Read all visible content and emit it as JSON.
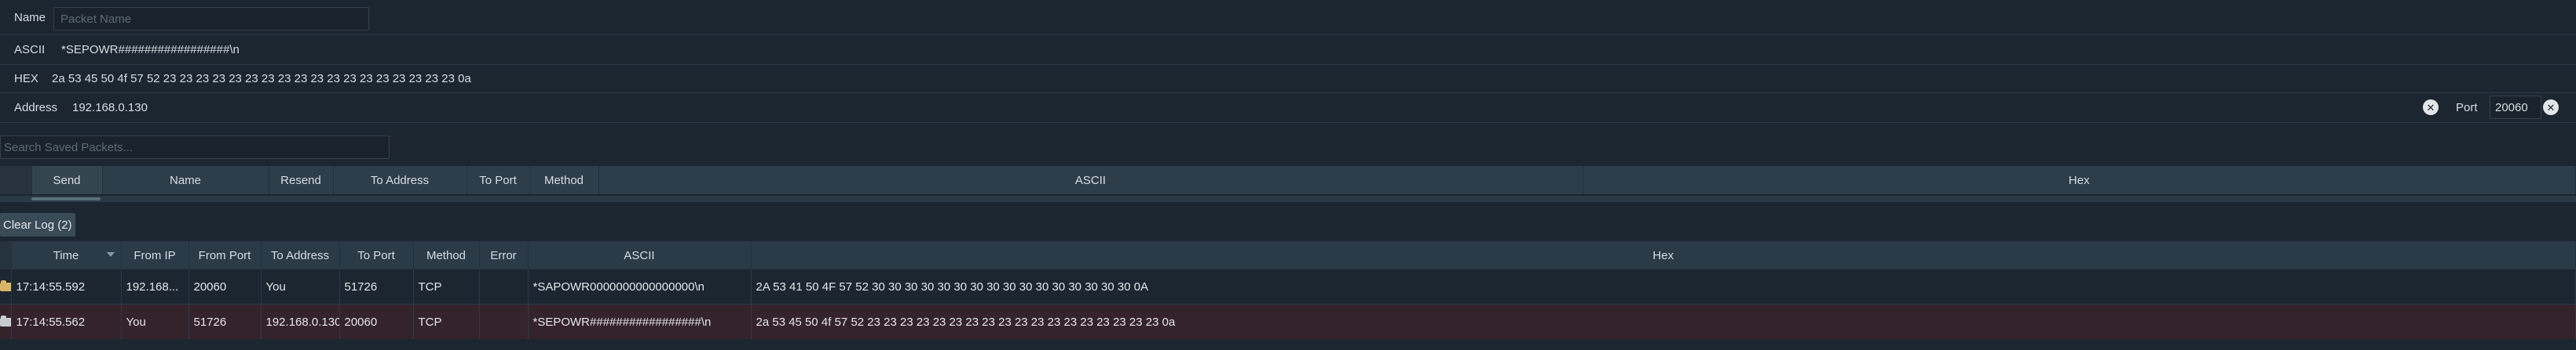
{
  "form": {
    "name_label": "Name",
    "name_placeholder": "Packet Name",
    "ascii_label": "ASCII",
    "ascii_value": "*SEPOWR#################\\n",
    "hex_label": "HEX",
    "hex_value": "2a 53 45 50 4f 57 52 23 23 23 23 23 23 23 23 23 23 23 23 23 23 23 23 23 23 0a",
    "address_label": "Address",
    "address_value": "192.168.0.130",
    "port_label": "Port",
    "port_value": "20060",
    "clear_glyph": "✕"
  },
  "saved": {
    "search_placeholder": "Search Saved Packets...",
    "columns": [
      "Send",
      "Name",
      "Resend",
      "To Address",
      "To Port",
      "Method",
      "ASCII",
      "Hex"
    ]
  },
  "log": {
    "clear_button_label": "Clear Log (2)",
    "columns": [
      "Time",
      "From IP",
      "From Port",
      "To Address",
      "To Port",
      "Method",
      "Error",
      "ASCII",
      "Hex"
    ],
    "rows": [
      {
        "icon": "folder-open-icon",
        "icon_color": "#d9b56a",
        "time": "17:14:55.592",
        "from_ip": "192.168...",
        "from_port": "20060",
        "to_address": "You",
        "to_port": "51726",
        "method": "TCP",
        "error": "",
        "ascii": "*SAPOWR0000000000000000\\n",
        "hex": "2A 53 41 50 4F 57 52 30 30 30 30 30 30 30 30 30 30 30 30 30 30 30 30 0A"
      },
      {
        "icon": "folder-closed-icon",
        "icon_color": "#c7ccd1",
        "time": "17:14:55.562",
        "from_ip": "You",
        "from_port": "51726",
        "to_address": "192.168.0.130",
        "to_port": "20060",
        "method": "TCP",
        "error": "",
        "ascii": "*SEPOWR#################\\n",
        "hex": "2a 53 45 50 4f 57 52 23 23 23 23 23 23 23 23 23 23 23 23 23 23 23 23 23 23 0a"
      }
    ]
  },
  "colors": {
    "background": "#1c2630",
    "header": "#2d3d4a",
    "received_row": "#1c2630",
    "sent_row": "#35232c"
  }
}
